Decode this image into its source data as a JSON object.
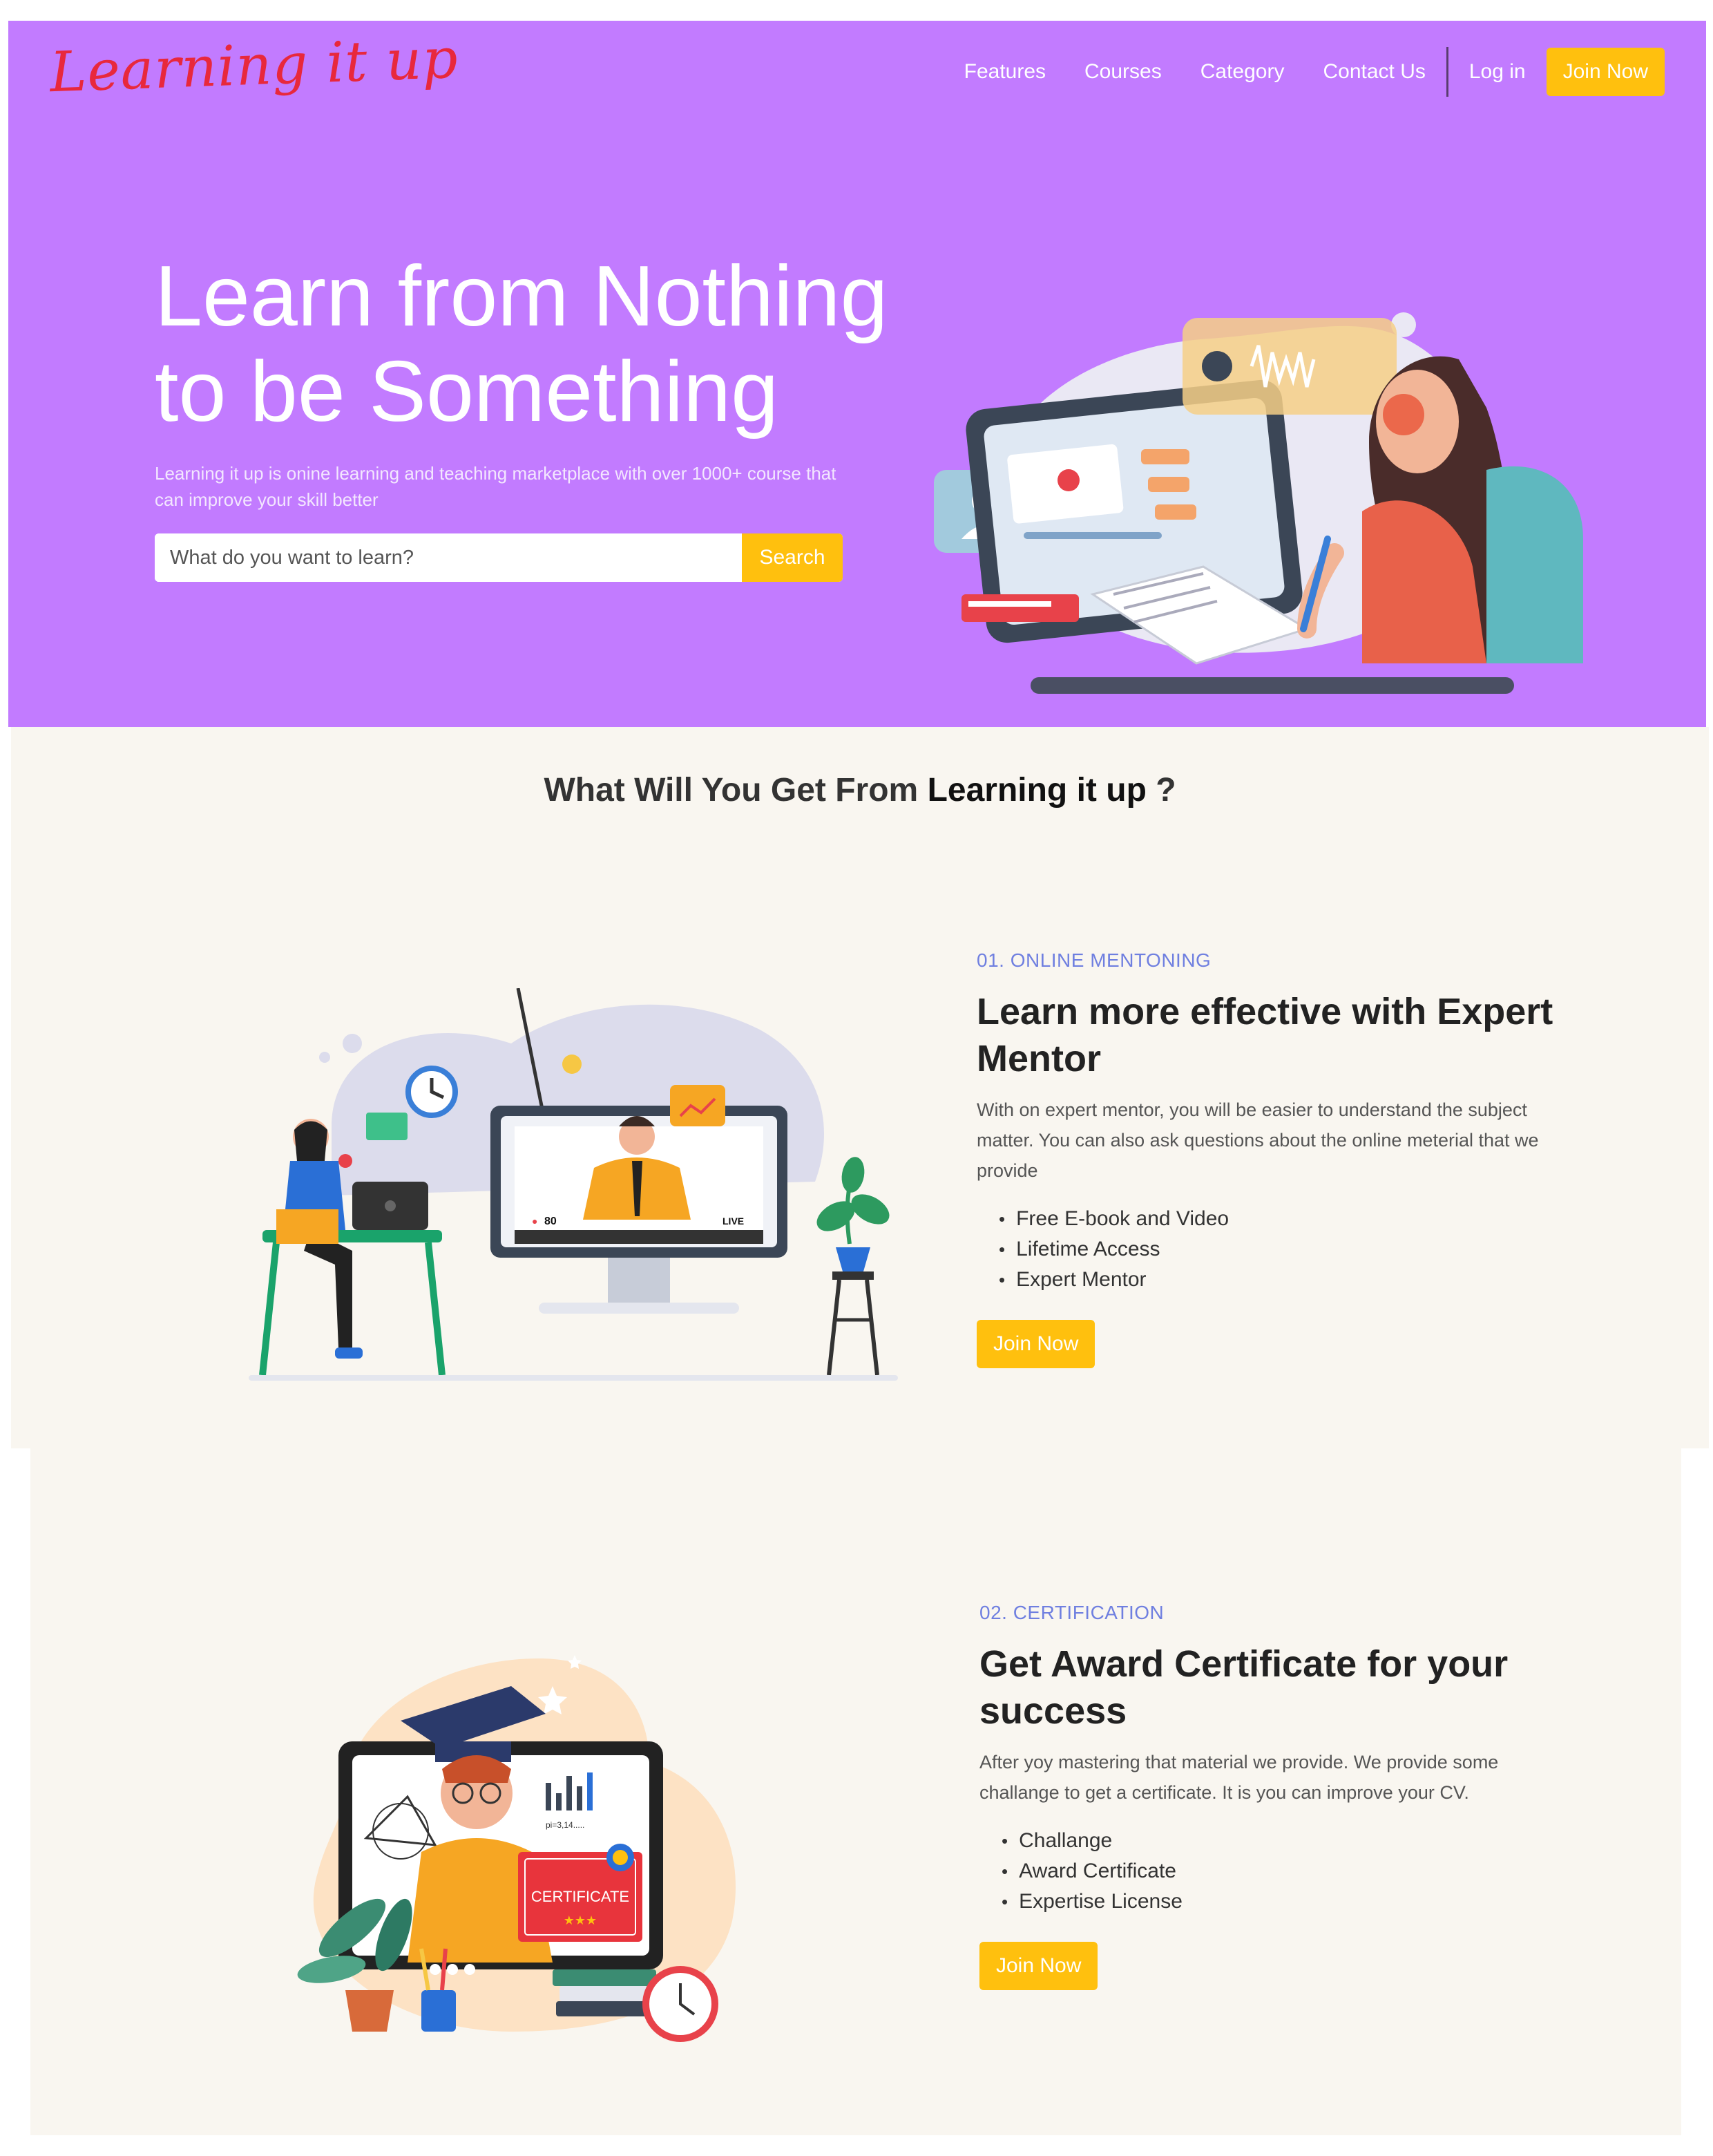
{
  "header": {
    "logo": "Learning it up",
    "nav": [
      "Features",
      "Courses",
      "Category",
      "Contact Us"
    ],
    "login": "Log in",
    "join": "Join Now"
  },
  "hero": {
    "title_line1": "Learn from Nothing",
    "title_line2": "to be Something",
    "subtitle": "Learning it up is onine learning and teaching marketplace with over 1000+ course that can improve your skill better",
    "search_placeholder": "What do you want to learn?",
    "search_button": "Search"
  },
  "features": {
    "heading_prefix": "What Will You Get From ",
    "heading_brand": "Learning it up",
    "heading_suffix": " ?",
    "items": [
      {
        "tag": "01. ONLINE MENTONING",
        "title": "Learn more effective with Expert Mentor",
        "description": "With on expert mentor, you will be easier to understand the subject matter. You can also ask questions about the online meterial that we provide",
        "bullets": [
          "Free E-book and Video",
          "Lifetime Access",
          "Expert Mentor"
        ],
        "button": "Join Now",
        "illustration": {
          "viewer_count": "80",
          "live_label": "LIVE"
        }
      },
      {
        "tag": "02. CERTIFICATION",
        "title": "Get Award Certificate for your success",
        "description": "After yoy mastering that material we provide. We provide some challange to get a certificate. It is you can improve your CV.",
        "bullets": [
          "Challange",
          "Award Certificate",
          "Expertise License"
        ],
        "button": "Join Now",
        "illustration": {
          "certificate_label": "CERTIFICATE",
          "pi_label": "pi=3,14....."
        }
      }
    ]
  },
  "colors": {
    "hero_bg": "#c27bff",
    "accent": "#ffc00e",
    "logo": "#e8283c",
    "tag": "#6f7fe0",
    "section_bg": "#f9f6f0"
  }
}
